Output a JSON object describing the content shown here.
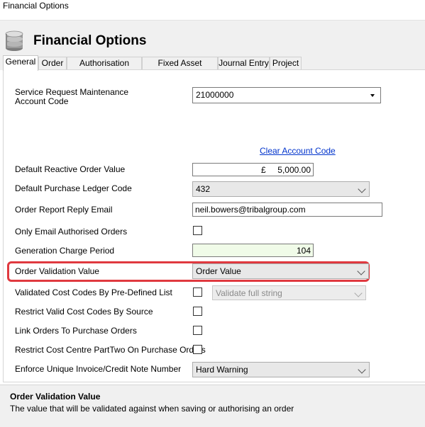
{
  "window": {
    "title": "Financial Options"
  },
  "header": {
    "title": "Financial Options",
    "icon": "database-icon"
  },
  "tabs": [
    {
      "label": "General",
      "active": true
    },
    {
      "label": "Order",
      "active": false
    },
    {
      "label": "Authorisation Matrix",
      "active": false
    },
    {
      "label": "Fixed Asset Register",
      "active": false
    },
    {
      "label": "Journal Entry",
      "active": false
    },
    {
      "label": "Project",
      "active": false
    }
  ],
  "form": {
    "service_request": {
      "label_line1": "Service Request Maintenance",
      "label_line2": "Account Code",
      "value": "21000000"
    },
    "clear_account_code": "Clear Account Code",
    "default_reactive_order_value": {
      "label": "Default Reactive Order Value",
      "currency": "£",
      "value": "5,000.00"
    },
    "default_purchase_ledger_code": {
      "label": "Default Purchase Ledger Code",
      "value": "432"
    },
    "order_report_reply_email": {
      "label": "Order Report Reply Email",
      "value": "neil.bowers@tribalgroup.com"
    },
    "only_email_authorised_orders": {
      "label": "Only Email Authorised Orders",
      "checked": false
    },
    "generation_charge_period": {
      "label": "Generation Charge Period",
      "value": "104"
    },
    "order_validation_value": {
      "label": "Order Validation Value",
      "value": "Order Value"
    },
    "validated_cost_codes": {
      "label": "Validated Cost Codes By Pre-Defined List",
      "checked": false,
      "option": "Validate full string"
    },
    "restrict_valid_cost_codes": {
      "label": "Restrict Valid Cost Codes By Source",
      "checked": false
    },
    "link_orders": {
      "label": "Link Orders To Purchase Orders",
      "checked": false
    },
    "restrict_cost_centre": {
      "label": "Restrict Cost Centre PartTwo On Purchase Orders",
      "checked": false
    },
    "enforce_unique_invoice": {
      "label": "Enforce Unique Invoice/Credit Note Number",
      "value": "Hard Warning"
    }
  },
  "footer": {
    "title": "Order Validation Value",
    "description": "The value that will be validated against when saving or authorising an order"
  },
  "colors": {
    "highlight": "#e0393f",
    "link": "#0033cc"
  }
}
